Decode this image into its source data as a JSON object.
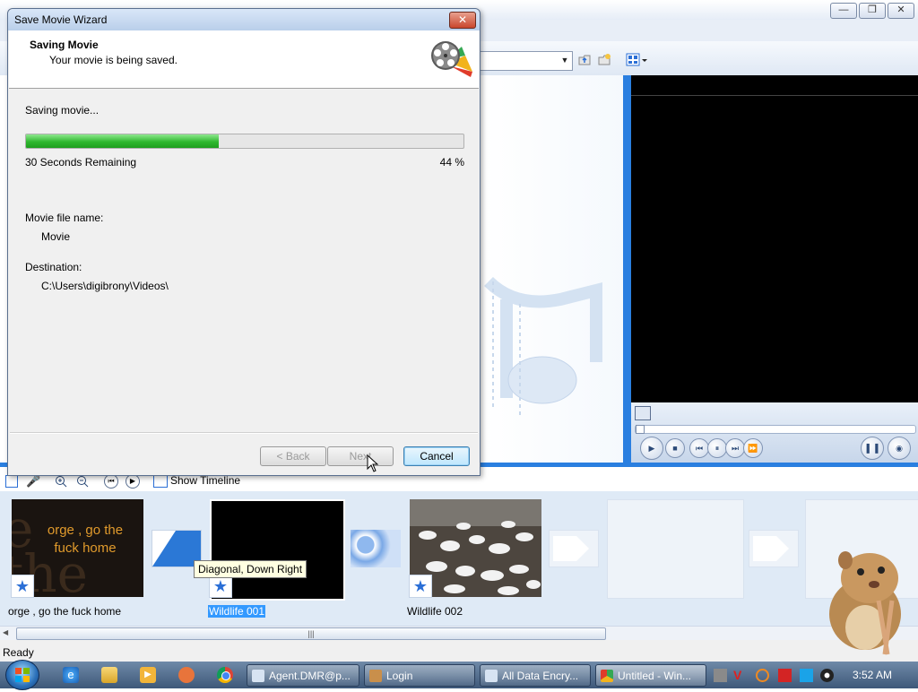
{
  "background_app": {
    "status": "Ready",
    "storyboard": {
      "show_timeline_label": "Show Timeline",
      "clips": [
        {
          "label": "orge , go the fuck home",
          "thumb_text_line1": "orge , go the",
          "thumb_text_line2": "fuck home",
          "selected": false
        },
        {
          "label": "Wildlife 001",
          "selected": true
        },
        {
          "label": "Wildlife 002",
          "selected": false
        }
      ],
      "tooltip": "Diagonal, Down Right"
    }
  },
  "dialog": {
    "title": "Save Movie Wizard",
    "close_glyph": "✕",
    "header_title": "Saving Movie",
    "header_subtitle": "Your movie is being saved.",
    "status_text": "Saving movie...",
    "progress_percent": 44,
    "remaining": "30 Seconds Remaining",
    "percent_label": "44 %",
    "file_name_label": "Movie file name:",
    "file_name_value": "Movie",
    "destination_label": "Destination:",
    "destination_value": "C:\\Users\\digibrony\\Videos\\",
    "buttons": {
      "back": "< Back",
      "next": "Next",
      "cancel": "Cancel"
    }
  },
  "taskbar": {
    "items": [
      {
        "label": "Agent.DMR@p..."
      },
      {
        "label": "Login"
      },
      {
        "label": "All Data Encry..."
      },
      {
        "label": "Untitled - Win..."
      }
    ],
    "clock": "3:52 AM"
  },
  "colors": {
    "progress_green": "#2fb82f",
    "accent_blue": "#2a7fe0",
    "selected_highlight": "#3399ff"
  }
}
